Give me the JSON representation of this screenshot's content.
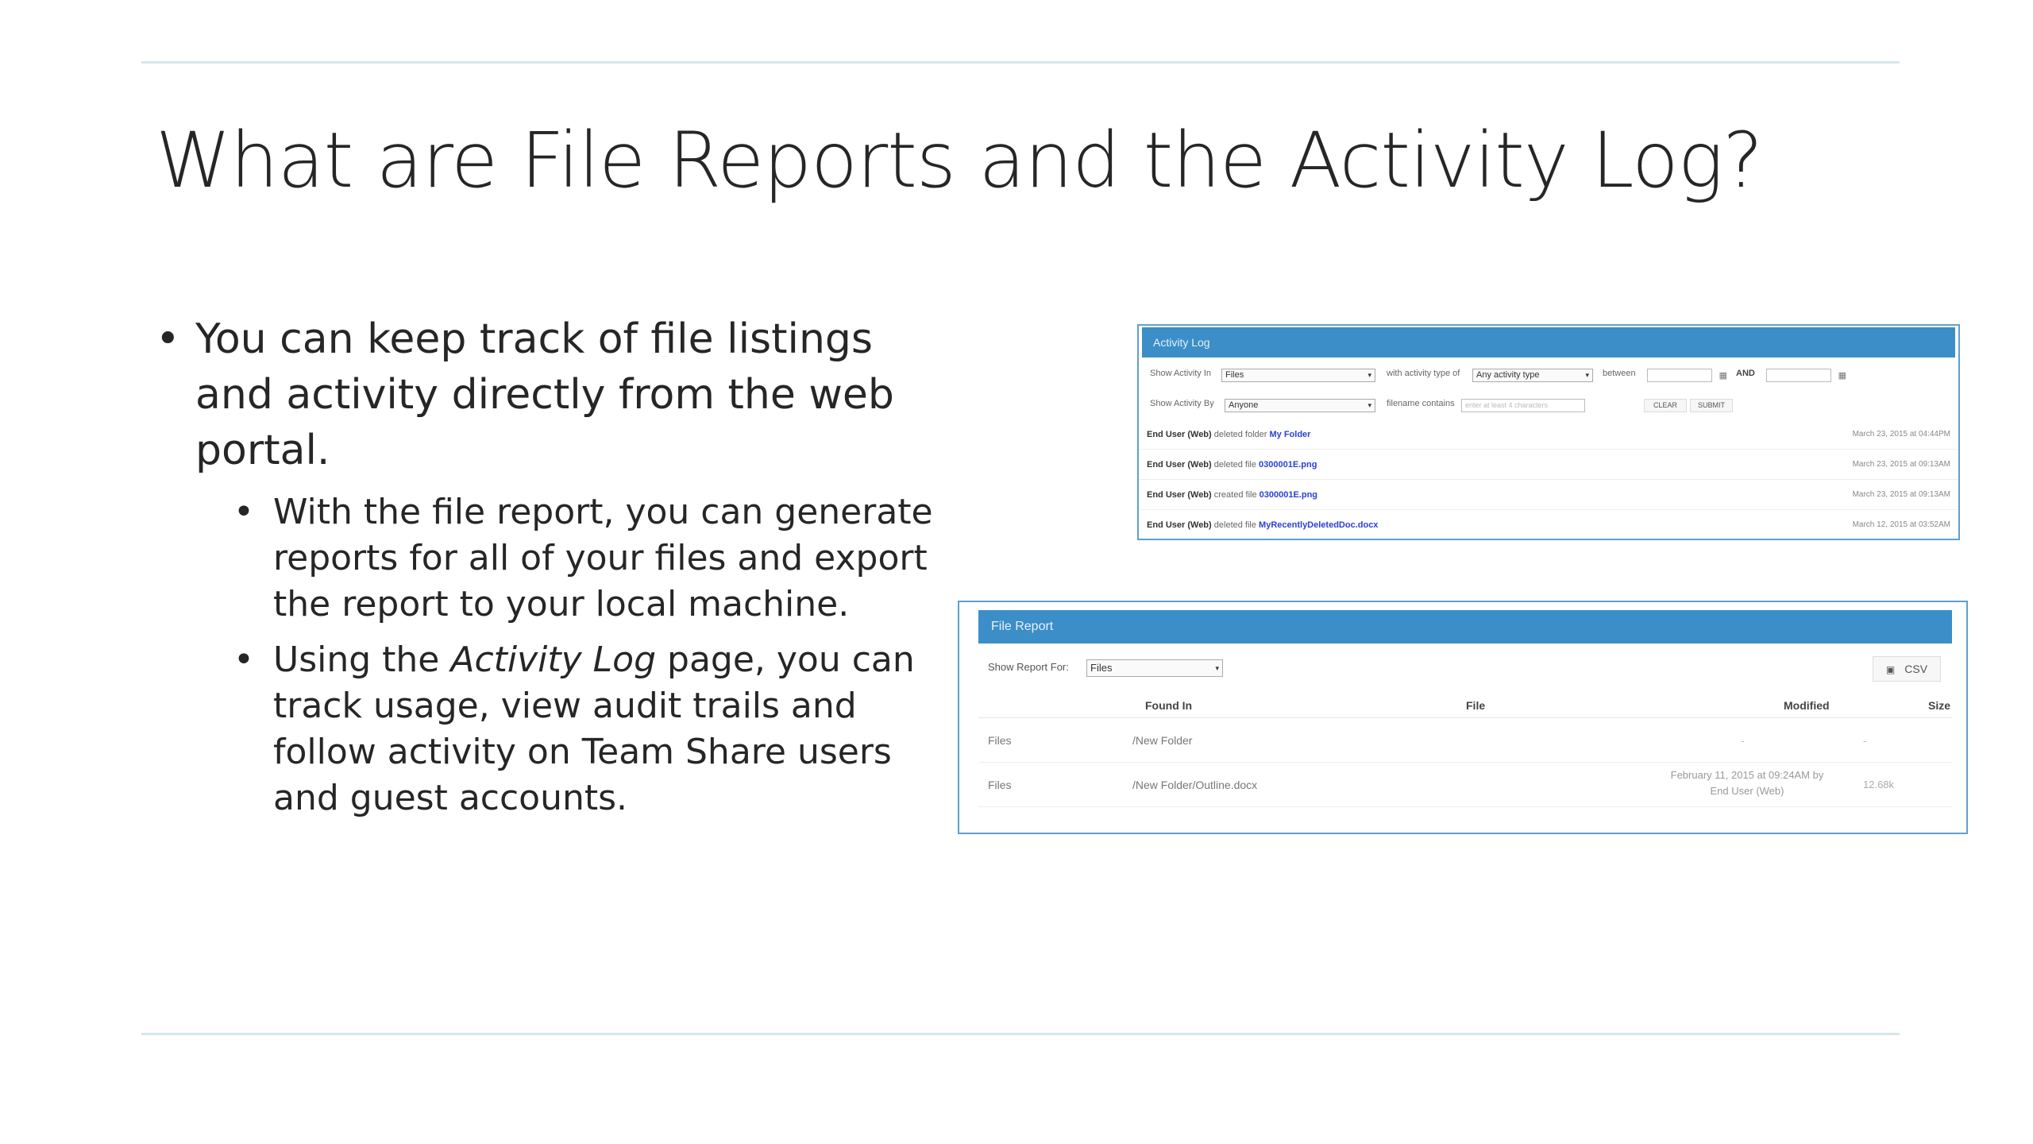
{
  "slide": {
    "title": "What are File Reports and the Activity Log?",
    "bullets": {
      "main": "You can keep track of file listings and activity directly from the web portal.",
      "sub1": "With the file report, you can generate reports for all of your files and export the report to your local machine.",
      "sub2_pre": "Using the ",
      "sub2_em": "Activity Log",
      "sub2_post": " page, you can track usage, view audit trails and follow activity on Team Share users and guest accounts."
    }
  },
  "activity_log": {
    "title": "Activity Log",
    "show_activity_in_label": "Show Activity In",
    "show_activity_in_value": "Files",
    "activity_type_label": "with activity type of",
    "activity_type_value": "Any activity type",
    "between_label": "between",
    "and_label": "AND",
    "show_activity_by_label": "Show Activity By",
    "show_activity_by_value": "Anyone",
    "filename_label": "filename contains",
    "filename_placeholder": "enter at least 4 characters",
    "clear_label": "CLEAR",
    "submit_label": "SUBMIT",
    "entries": [
      {
        "who": "End User (Web)",
        "action": "deleted folder",
        "target": "My Folder",
        "date": "March 23, 2015 at 04:44PM"
      },
      {
        "who": "End User (Web)",
        "action": "deleted file",
        "target": "0300001E.png",
        "date": "March 23, 2015 at 09:13AM"
      },
      {
        "who": "End User (Web)",
        "action": "created file",
        "target": "0300001E.png",
        "date": "March 23, 2015 at 09:13AM"
      },
      {
        "who": "End User (Web)",
        "action": "deleted file",
        "target": "MyRecentlyDeletedDoc.docx",
        "date": "March 12, 2015 at 03:52AM"
      }
    ]
  },
  "file_report": {
    "title": "File Report",
    "show_report_for_label": "Show Report For:",
    "show_report_for_value": "Files",
    "csv_label": "CSV",
    "columns": [
      "Found In",
      "File",
      "Modified",
      "Size"
    ],
    "rows": [
      {
        "type": "Files",
        "found_in": "/New Folder",
        "modified_line1": "-",
        "modified_line2": "",
        "size": "-"
      },
      {
        "type": "Files",
        "found_in": "/New Folder/Outline.docx",
        "modified_line1": "February 11, 2015 at 09:24AM by",
        "modified_line2": "End User (Web)",
        "size": "12.68k"
      }
    ]
  },
  "icons": {
    "bullet": "•",
    "dropdown": "▾",
    "calendar": "▦",
    "save": "🖫"
  },
  "colors": {
    "panel_header": "#3b8ec8",
    "panel_border": "#5f9fcf",
    "link": "#2a3fd6",
    "rule": "#d6e6ea"
  }
}
